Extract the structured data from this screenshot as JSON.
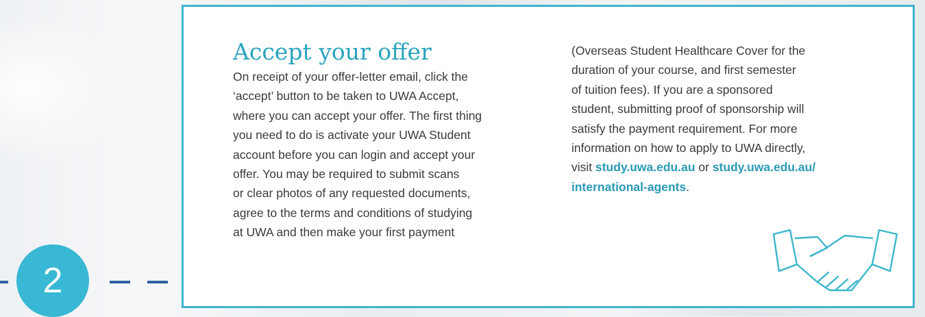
{
  "step": {
    "number": "2"
  },
  "section": {
    "title": "Accept your offer",
    "left_lines": [
      "On receipt of your offer-letter email, click the",
      "‘accept’ button to be taken to UWA Accept,",
      "where you can accept your offer. The first thing",
      "you need to do is activate your UWA Student",
      "account before you can login and accept your",
      "offer. You may be required to submit scans",
      "or clear photos of any requested documents,",
      "agree to the terms and conditions of studying",
      "at UWA and then make your first payment"
    ],
    "right_lines": [
      "(Overseas Student Healthcare Cover for the",
      "duration of your course, and first semester",
      "of tuition fees). If you are a sponsored",
      "student, submitting proof of sponsorship will",
      "satisfy the payment requirement. For more",
      "information on how to apply to UWA directly,"
    ],
    "visit_prefix": "visit ",
    "link1": "study.uwa.edu.au",
    "or_text": " or ",
    "link2_part1": "study.uwa.edu.au/",
    "link2_part2": "international-agents",
    "end_period": "."
  },
  "icons": {
    "handshake": "handshake-icon"
  },
  "colors": {
    "accent": "#3cb6cc",
    "title": "#2aa3be",
    "circle": "#38b8d4",
    "dash": "#2f5fa0"
  }
}
